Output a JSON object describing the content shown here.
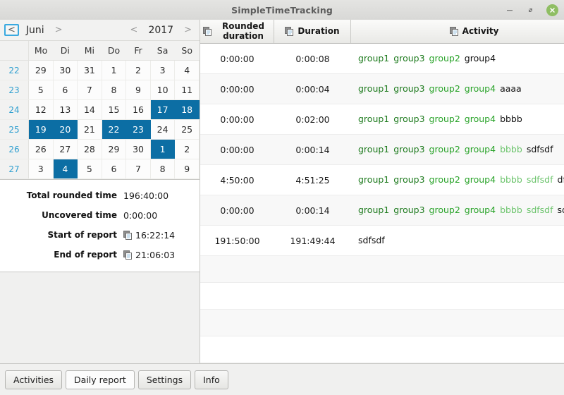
{
  "window": {
    "title": "SimpleTimeTracking",
    "minimize_label": "−",
    "restore_label": "❐",
    "close_label": "✕"
  },
  "calendar": {
    "prev_month_label": "<",
    "month_label": "Juni",
    "next_month_label": ">",
    "prev_year_label": "<",
    "year_label": "2017",
    "next_year_label": ">",
    "weekday_header_blank": "",
    "weekdays": [
      "Mo",
      "Di",
      "Mi",
      "Do",
      "Fr",
      "Sa",
      "So"
    ],
    "weeks": [
      {
        "week": "22",
        "days": [
          "29",
          "30",
          "31",
          "1",
          "2",
          "3",
          "4"
        ],
        "selected": [
          false,
          false,
          false,
          false,
          false,
          false,
          false
        ]
      },
      {
        "week": "23",
        "days": [
          "5",
          "6",
          "7",
          "8",
          "9",
          "10",
          "11"
        ],
        "selected": [
          false,
          false,
          false,
          false,
          false,
          false,
          false
        ]
      },
      {
        "week": "24",
        "days": [
          "12",
          "13",
          "14",
          "15",
          "16",
          "17",
          "18"
        ],
        "selected": [
          false,
          false,
          false,
          false,
          false,
          true,
          true
        ]
      },
      {
        "week": "25",
        "days": [
          "19",
          "20",
          "21",
          "22",
          "23",
          "24",
          "25"
        ],
        "selected": [
          true,
          true,
          false,
          true,
          true,
          false,
          false
        ]
      },
      {
        "week": "26",
        "days": [
          "26",
          "27",
          "28",
          "29",
          "30",
          "1",
          "2"
        ],
        "selected": [
          false,
          false,
          false,
          false,
          false,
          true,
          false
        ]
      },
      {
        "week": "27",
        "days": [
          "3",
          "4",
          "5",
          "6",
          "7",
          "8",
          "9"
        ],
        "selected": [
          false,
          true,
          false,
          false,
          false,
          false,
          false
        ]
      }
    ]
  },
  "summary": {
    "rows": [
      {
        "label": "Total rounded time",
        "value": "196:40:00",
        "has_copy_icon": false
      },
      {
        "label": "Uncovered time",
        "value": "0:00:00",
        "has_copy_icon": false
      },
      {
        "label": "Start of report",
        "value": "16:22:14",
        "has_copy_icon": true
      },
      {
        "label": "End of report",
        "value": "21:06:03",
        "has_copy_icon": true
      }
    ]
  },
  "table": {
    "columns": [
      {
        "label": "Rounded duration",
        "icon": "copy-icon",
        "sorted": false
      },
      {
        "label": "Duration",
        "icon": "copy-icon",
        "sorted": false
      },
      {
        "label": "Activity",
        "icon": "copy-icon",
        "sorted": true,
        "sort_direction": "ascending"
      }
    ],
    "rows": [
      {
        "rounded": "0:00:00",
        "duration": "0:00:08",
        "activity_segments": [
          {
            "text": "group1",
            "tone": "g1"
          },
          {
            "text": "group3",
            "tone": "g1"
          },
          {
            "text": "group2",
            "tone": "g2"
          },
          {
            "text": "group4",
            "tone": "last"
          }
        ]
      },
      {
        "rounded": "0:00:00",
        "duration": "0:00:04",
        "activity_segments": [
          {
            "text": "group1",
            "tone": "g1"
          },
          {
            "text": "group3",
            "tone": "g1"
          },
          {
            "text": "group2",
            "tone": "g2"
          },
          {
            "text": "group4",
            "tone": "g2"
          },
          {
            "text": "aaaa",
            "tone": "last"
          }
        ]
      },
      {
        "rounded": "0:00:00",
        "duration": "0:02:00",
        "activity_segments": [
          {
            "text": "group1",
            "tone": "g1"
          },
          {
            "text": "group3",
            "tone": "g1"
          },
          {
            "text": "group2",
            "tone": "g2"
          },
          {
            "text": "group4",
            "tone": "g2"
          },
          {
            "text": "bbbb",
            "tone": "last"
          }
        ]
      },
      {
        "rounded": "0:00:00",
        "duration": "0:00:14",
        "activity_segments": [
          {
            "text": "group1",
            "tone": "g1"
          },
          {
            "text": "group3",
            "tone": "g1"
          },
          {
            "text": "group2",
            "tone": "g2"
          },
          {
            "text": "group4",
            "tone": "g2"
          },
          {
            "text": "bbbb",
            "tone": "g3"
          },
          {
            "text": "sdfsdf",
            "tone": "last"
          }
        ]
      },
      {
        "rounded": "4:50:00",
        "duration": "4:51:25",
        "activity_segments": [
          {
            "text": "group1",
            "tone": "g1"
          },
          {
            "text": "group3",
            "tone": "g1"
          },
          {
            "text": "group2",
            "tone": "g2"
          },
          {
            "text": "group4",
            "tone": "g2"
          },
          {
            "text": "bbbb",
            "tone": "g3"
          },
          {
            "text": "sdfsdf",
            "tone": "g3"
          },
          {
            "text": "dfgdfg",
            "tone": "last"
          }
        ]
      },
      {
        "rounded": "0:00:00",
        "duration": "0:00:14",
        "activity_segments": [
          {
            "text": "group1",
            "tone": "g1"
          },
          {
            "text": "group3",
            "tone": "g1"
          },
          {
            "text": "group2",
            "tone": "g2"
          },
          {
            "text": "group4",
            "tone": "g2"
          },
          {
            "text": "bbbb",
            "tone": "g3"
          },
          {
            "text": "sdfsdf",
            "tone": "g3"
          },
          {
            "text": "sdfsdf",
            "tone": "last"
          }
        ]
      },
      {
        "rounded": "191:50:00",
        "duration": "191:49:44",
        "activity_segments": [
          {
            "text": "sdfsdf",
            "tone": "last"
          }
        ]
      }
    ],
    "empty_row_count": 4
  },
  "tabs": [
    {
      "label": "Activities",
      "active": false
    },
    {
      "label": "Daily report",
      "active": true
    },
    {
      "label": "Settings",
      "active": false
    },
    {
      "label": "Info",
      "active": false
    }
  ],
  "colors": {
    "selection_blue": "#0c6ea4",
    "week_number_blue": "#2f9fd0",
    "group_green_dark": "#1d7a1d",
    "group_green": "#29a329",
    "group_green_light": "#6cc46c",
    "close_button_green": "#8fbe63",
    "focus_border_blue": "#39a9e0"
  }
}
